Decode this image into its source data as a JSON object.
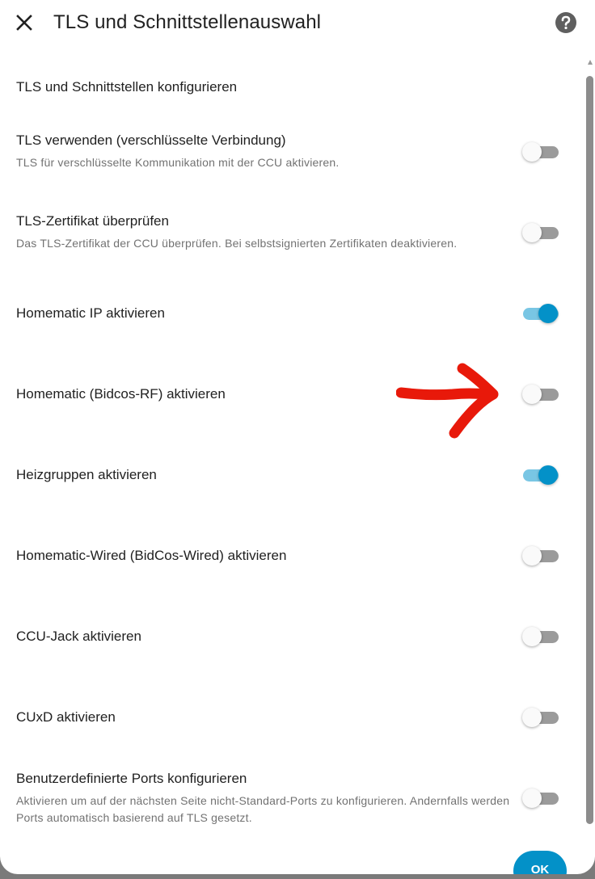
{
  "dialog": {
    "title": "TLS und Schnittstellenauswahl",
    "close_icon": "close-icon",
    "help_icon": "help-circle-icon"
  },
  "section": {
    "heading": "TLS und Schnittstellen konfigurieren"
  },
  "settings": [
    {
      "title": "TLS verwenden (verschlüsselte Verbindung)",
      "description": "TLS für verschlüsselte Kommunikation mit der CCU aktivieren.",
      "enabled": false
    },
    {
      "title": "TLS-Zertifikat überprüfen",
      "description": "Das TLS-Zertifikat der CCU überprüfen. Bei selbstsignierten Zertifikaten deaktivieren.",
      "enabled": false
    },
    {
      "title": "Homematic IP aktivieren",
      "enabled": true
    },
    {
      "title": "Homematic (Bidcos-RF) aktivieren",
      "enabled": false
    },
    {
      "title": "Heizgruppen aktivieren",
      "enabled": true
    },
    {
      "title": "Homematic-Wired (BidCos-Wired) aktivieren",
      "enabled": false
    },
    {
      "title": "CCU-Jack aktivieren",
      "enabled": false
    },
    {
      "title": "CUxD aktivieren",
      "enabled": false
    },
    {
      "title": "Benutzerdefinierte Ports konfigurieren",
      "description": "Aktivieren um auf der nächsten Seite nicht-Standard-Ports zu konfigurieren. Andernfalls werden Ports automatisch basierend auf TLS gesetzt.",
      "enabled": false
    }
  ],
  "footer": {
    "ok_label": "OK"
  },
  "colors": {
    "accent": "#0391c8",
    "accent_track": "#79c6e4",
    "off_track": "#9b9b9b",
    "annotation_arrow": "#e8190a"
  },
  "annotation": {
    "icon": "red-arrow-annotation-icon"
  }
}
